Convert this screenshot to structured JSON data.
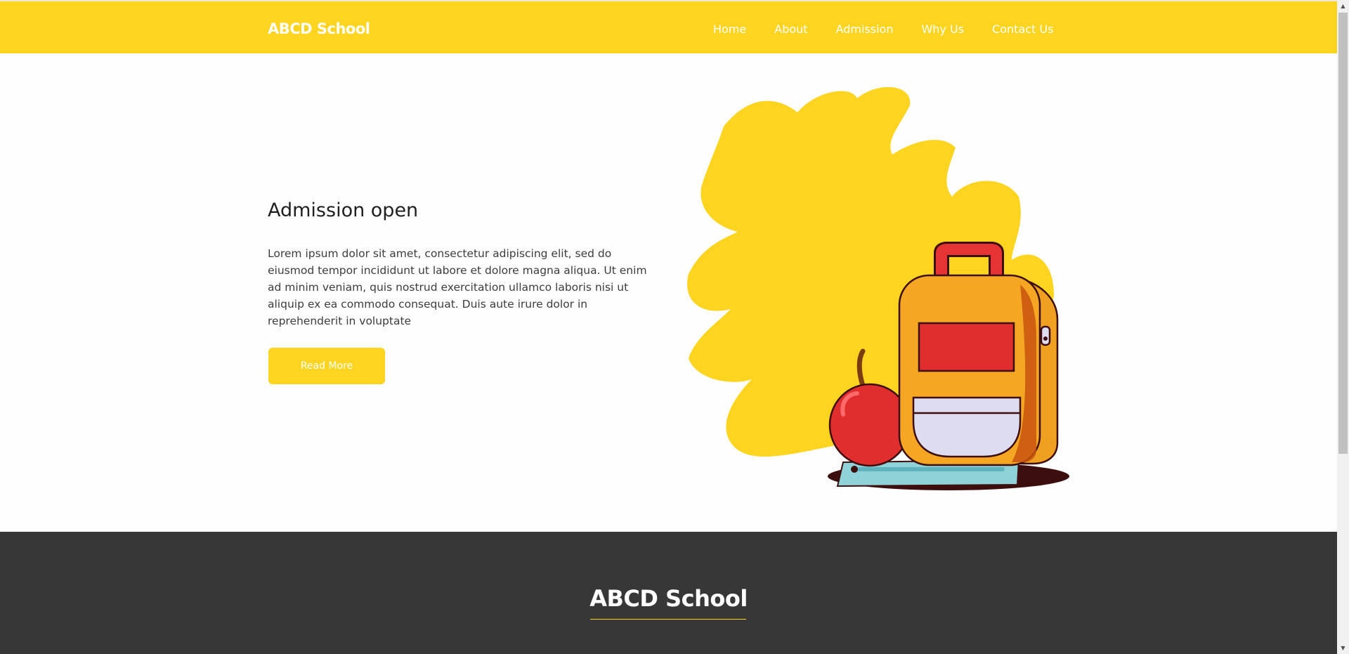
{
  "header": {
    "brand": "ABCD School",
    "nav": [
      "Home",
      "About",
      "Admission",
      "Why Us",
      "Contact Us"
    ]
  },
  "hero": {
    "title": "Admission open",
    "text": "Lorem ipsum dolor sit amet, consectetur adipiscing elit, sed do eiusmod tempor incididunt ut labore et dolore magna aliqua. Ut enim ad minim veniam, quis nostrud exercitation ullamco laboris nisi ut aliquip ex ea commodo consequat. Duis aute irure dolor in reprehenderit in voluptate",
    "button": "Read More"
  },
  "footer": {
    "brand": "ABCD School"
  },
  "colors": {
    "accent": "#fdd41f",
    "footer_bg": "#373737",
    "text": "#3c3c3c"
  },
  "icons": {
    "illustration": "backpack-apple-ruler-illustration",
    "scroll_up": "scroll-up-arrow-icon",
    "scroll_down": "scroll-down-arrow-icon"
  }
}
